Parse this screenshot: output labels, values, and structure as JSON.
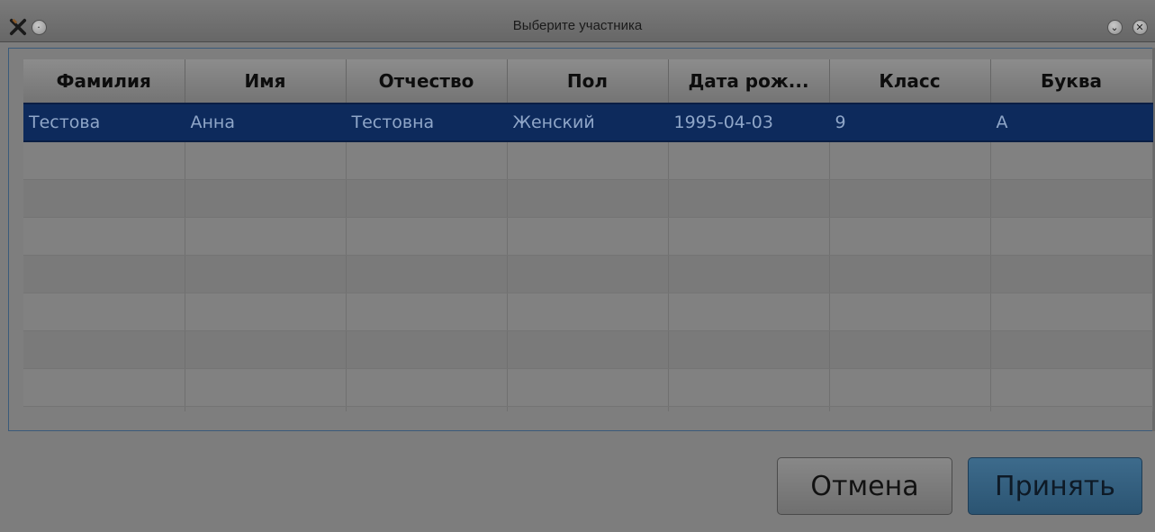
{
  "window": {
    "title": "Выберите участника"
  },
  "table": {
    "columns": [
      "Фамилия",
      "Имя",
      "Отчество",
      "Пол",
      "Дата рож...",
      "Класс",
      "Буква"
    ],
    "rows": [
      [
        "Тестова",
        "Анна",
        "Тестовна",
        "Женский",
        "1995-04-03",
        "9",
        "А"
      ]
    ]
  },
  "buttons": {
    "cancel_label": "Отмена",
    "accept_label": "Принять"
  },
  "colors": {
    "selection": "#0d2a5c",
    "accept_button": "#2f5a7a"
  },
  "icons": {
    "app": "app-tools-icon",
    "menu": "window-menu-icon",
    "minimize": "chevron-down-icon",
    "close": "close-icon"
  }
}
